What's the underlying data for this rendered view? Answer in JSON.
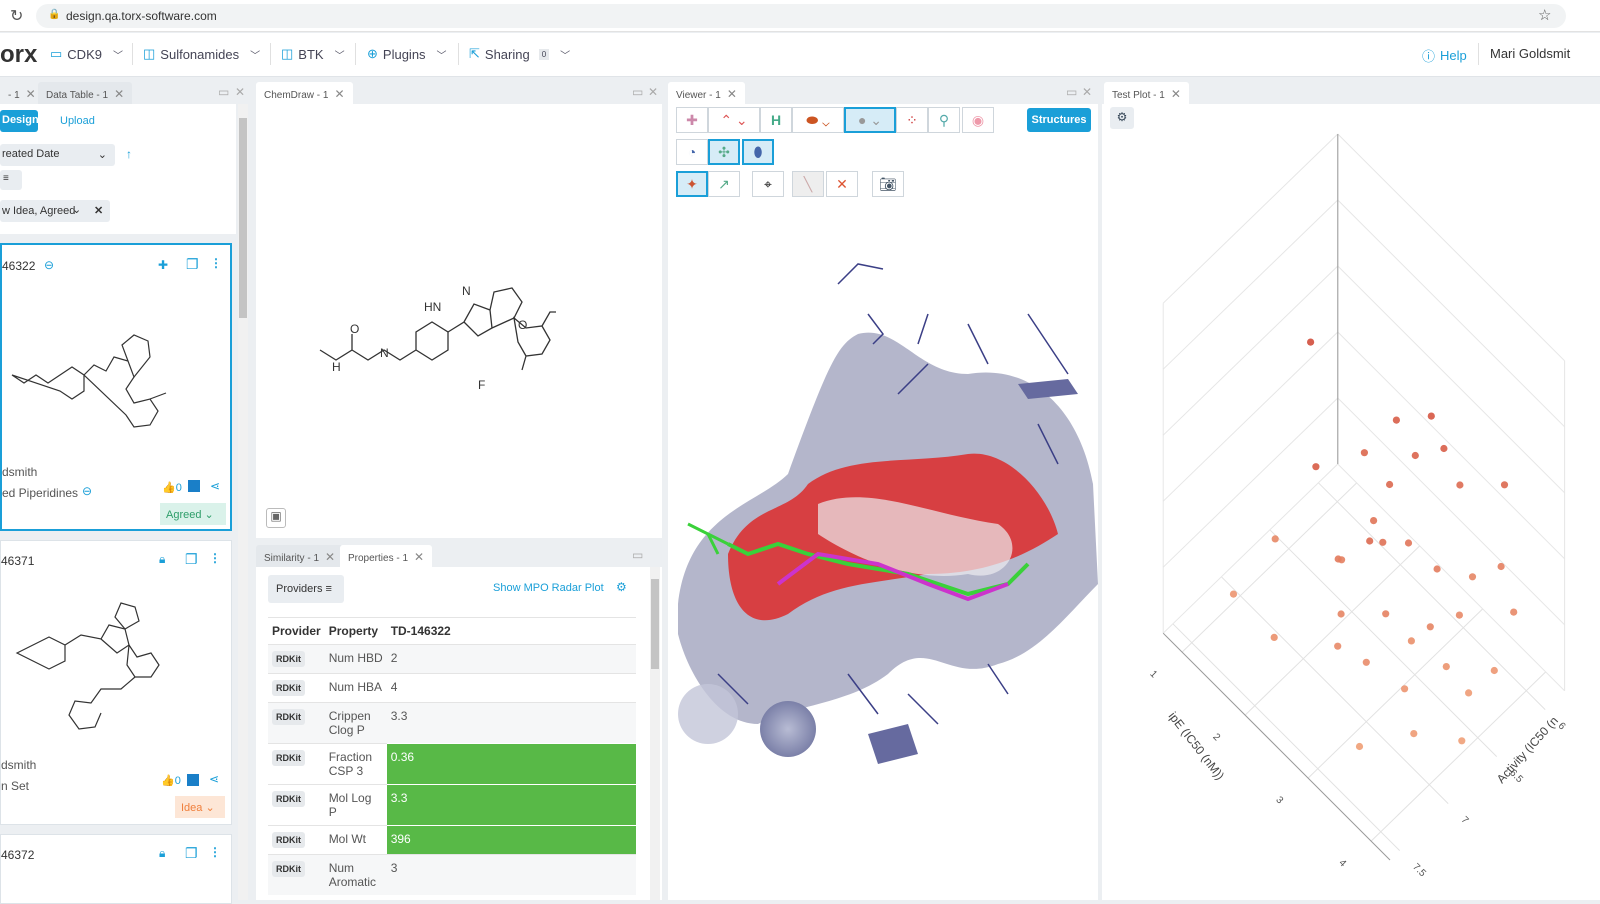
{
  "browser": {
    "url": "design.qa.torx-software.com"
  },
  "nav": {
    "logo": "orx",
    "items": [
      {
        "label": "CDK9"
      },
      {
        "label": "Sulfonamides"
      },
      {
        "label": "BTK"
      },
      {
        "label": "Plugins"
      },
      {
        "label": "Sharing",
        "badge": "0"
      }
    ],
    "help": "Help",
    "user": "Mari Goldsmit"
  },
  "left": {
    "tabs": [
      "- 1",
      "Data Table - 1"
    ],
    "design": "Design",
    "upload": "Upload",
    "sort": "reated Date",
    "filter": "w Idea, Agreed",
    "cards": [
      {
        "id": "46322",
        "author": "dsmith",
        "set": "ed Piperidines",
        "likes": "0",
        "status": "Agreed",
        "status_color": "#2e9e6a"
      },
      {
        "id": "46371",
        "author": "dsmith",
        "set": "n Set",
        "likes": "0",
        "status": "Idea",
        "status_color": "#f07f3c"
      },
      {
        "id": "46372"
      }
    ]
  },
  "chemdraw": {
    "tab": "ChemDraw - 1",
    "atoms": {
      "hn": "HN",
      "n": "N",
      "o": "O",
      "f": "F",
      "nh": "H",
      "n2": "N"
    }
  },
  "props": {
    "tabs": [
      "Similarity - 1",
      "Properties - 1"
    ],
    "providers": "Providers",
    "mpo": "Show MPO Radar Plot",
    "headers": [
      "Provider",
      "Property",
      "TD-146322"
    ],
    "rows": [
      {
        "p": "RDKit",
        "name": "Num HBD",
        "v": "2",
        "hl": false
      },
      {
        "p": "RDKit",
        "name": "Num HBA",
        "v": "4",
        "hl": false
      },
      {
        "p": "RDKit",
        "name": "Crippen Clog P",
        "v": "3.3",
        "hl": false
      },
      {
        "p": "RDKit",
        "name": "Fraction CSP 3",
        "v": "0.36",
        "hl": true
      },
      {
        "p": "RDKit",
        "name": "Mol Log P",
        "v": "3.3",
        "hl": true
      },
      {
        "p": "RDKit",
        "name": "Mol Wt",
        "v": "396",
        "hl": true
      },
      {
        "p": "RDKit",
        "name": "Num Aromatic",
        "v": "3",
        "hl": false
      }
    ]
  },
  "viewer": {
    "tab": "Viewer - 1",
    "structures": "Structures"
  },
  "plot": {
    "tab": "Test Plot - 1"
  },
  "chart_data": {
    "type": "scatter3d",
    "xlabel": "ipE (IC50 (nM))",
    "ylabel": "Activity (IC50 (n",
    "x_ticks": [
      "1",
      "2",
      "3",
      "4"
    ],
    "y_ticks": [
      "6",
      "6.5",
      "7",
      "7.5"
    ],
    "xlim": [
      0.7,
      4.3
    ],
    "ylim": [
      5.8,
      7.6
    ],
    "zlim": [
      0,
      1
    ],
    "points": [
      [
        1.5,
        6.6,
        0.75
      ],
      [
        2.2,
        7.0,
        0.62
      ],
      [
        2.9,
        6.9,
        0.5
      ],
      [
        1.4,
        6.9,
        0.22
      ],
      [
        1.2,
        7.2,
        0.1
      ],
      [
        2.0,
        7.3,
        0.15
      ],
      [
        2.4,
        6.9,
        0.35
      ],
      [
        2.8,
        6.7,
        0.42
      ],
      [
        2.6,
        6.5,
        0.5
      ],
      [
        2.7,
        6.3,
        0.55
      ],
      [
        3.0,
        6.2,
        0.6
      ],
      [
        3.1,
        6.1,
        0.48
      ],
      [
        2.5,
        6.6,
        0.4
      ],
      [
        2.9,
        6.5,
        0.38
      ],
      [
        3.2,
        6.4,
        0.33
      ],
      [
        2.3,
        6.8,
        0.3
      ],
      [
        2.6,
        7.0,
        0.25
      ],
      [
        3.0,
        6.8,
        0.27
      ],
      [
        3.4,
        6.3,
        0.2
      ],
      [
        3.3,
        6.1,
        0.24
      ],
      [
        3.6,
        6.0,
        0.3
      ],
      [
        3.1,
        6.6,
        0.15
      ],
      [
        3.5,
        6.5,
        0.12
      ],
      [
        3.8,
        6.2,
        0.08
      ],
      [
        3.7,
        6.4,
        0.05
      ],
      [
        3.3,
        6.8,
        0.1
      ],
      [
        3.9,
        6.6,
        0.0
      ],
      [
        3.0,
        7.0,
        0.18
      ],
      [
        3.6,
        6.9,
        0.05
      ],
      [
        2.8,
        6.2,
        0.66
      ],
      [
        3.5,
        5.9,
        0.5
      ],
      [
        2.4,
        6.3,
        0.6
      ],
      [
        3.4,
        6.6,
        0.25
      ],
      [
        2.2,
        6.5,
        0.52
      ],
      [
        3.8,
        6.0,
        0.2
      ],
      [
        3.2,
        7.2,
        0.02
      ],
      [
        2.7,
        7.1,
        0.2
      ]
    ]
  }
}
